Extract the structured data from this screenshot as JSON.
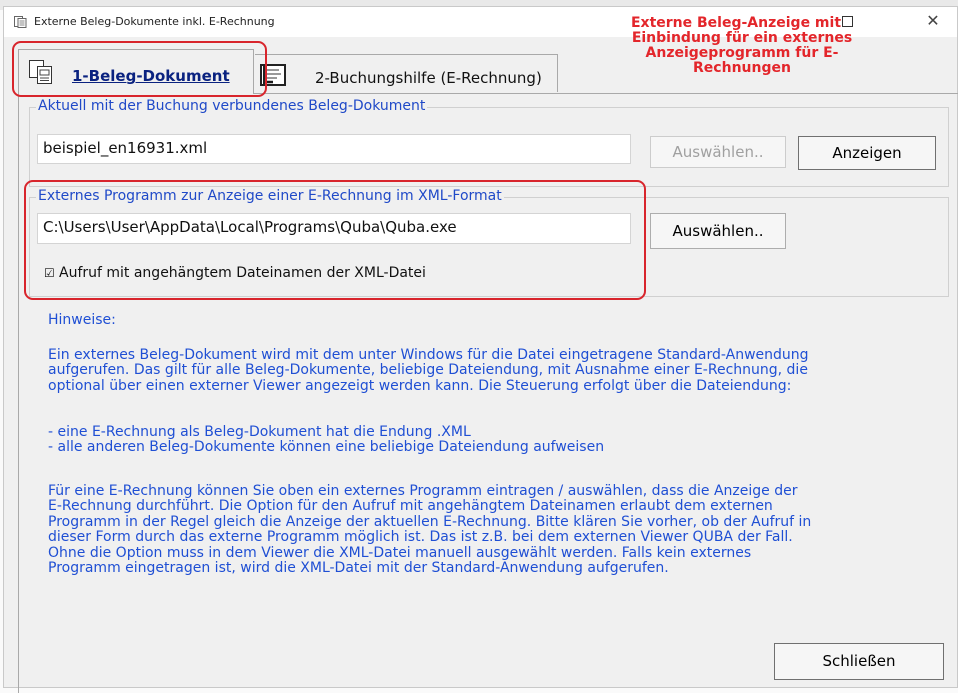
{
  "window": {
    "title": "Externe Beleg-Dokumente inkl. E-Rechnung",
    "close_glyph": "✕"
  },
  "annotation": {
    "lines": [
      "Externe Beleg-Anzeige mit",
      "Einbindung für ein externes",
      "Anzeigeprogramm für E-",
      "Rechnungen"
    ]
  },
  "tabs": [
    {
      "label": "1-Beleg-Dokument",
      "icon": "document-icon",
      "active": true
    },
    {
      "label": "2-Buchungshilfe (E-Rechnung)",
      "icon": "form-icon",
      "active": false
    }
  ],
  "group1": {
    "legend": "Aktuell mit der Buchung verbundenes Beleg-Dokument",
    "file_value": "beispiel_en16931.xml",
    "select_label": "Auswählen..",
    "show_label": "Anzeigen"
  },
  "group2": {
    "legend": "Externes Programm zur Anzeige einer E-Rechnung im XML-Format",
    "path_value": "C:\\Users\\User\\AppData\\Local\\Programs\\Quba\\Quba.exe",
    "select_label": "Auswählen..",
    "checkbox_label": "Aufruf mit angehängtem Dateinamen der XML-Datei",
    "checkbox_checked": true,
    "checkbox_glyph": "☑"
  },
  "notes": {
    "heading": "Hinweise:",
    "p1": "Ein externes Beleg-Dokument wird mit dem unter Windows für die Datei eingetragene Standard-Anwendung\naufgerufen. Das gilt für alle Beleg-Dokumente, beliebige Dateiendung, mit Ausnahme einer E-Rechnung, die\noptional über einen externer Viewer angezeigt werden kann. Die Steuerung erfolgt über die Dateiendung:",
    "p2": "- eine E-Rechnung als Beleg-Dokument hat die Endung .XML\n- alle anderen Beleg-Dokumente können eine beliebige Dateiendung aufweisen",
    "p3": "Für eine E-Rechnung können Sie oben ein externes Programm eintragen / auswählen, dass die Anzeige der\nE-Rechnung durchführt. Die Option für den Aufruf mit angehängtem Dateinamen erlaubt dem externen\nProgramm in der Regel gleich die Anzeige der aktuellen E-Rechnung. Bitte klären Sie vorher, ob der Aufruf in\ndieser Form durch das externe Programm möglich ist. Das ist z.B. bei dem externen Viewer QUBA der Fall.\nOhne die Option muss in dem Viewer die XML-Datei manuell ausgewählt werden. Falls kein externes\nProgramm eingetragen ist, wird die XML-Datei mit der Standard-Anwendung aufgerufen."
  },
  "footer": {
    "close_label": "Schließen"
  },
  "colors": {
    "annotation": "#e3262b",
    "highlight": "#d8252c",
    "link_text": "#1f4fd4",
    "tab_active_text": "#0a2280"
  }
}
